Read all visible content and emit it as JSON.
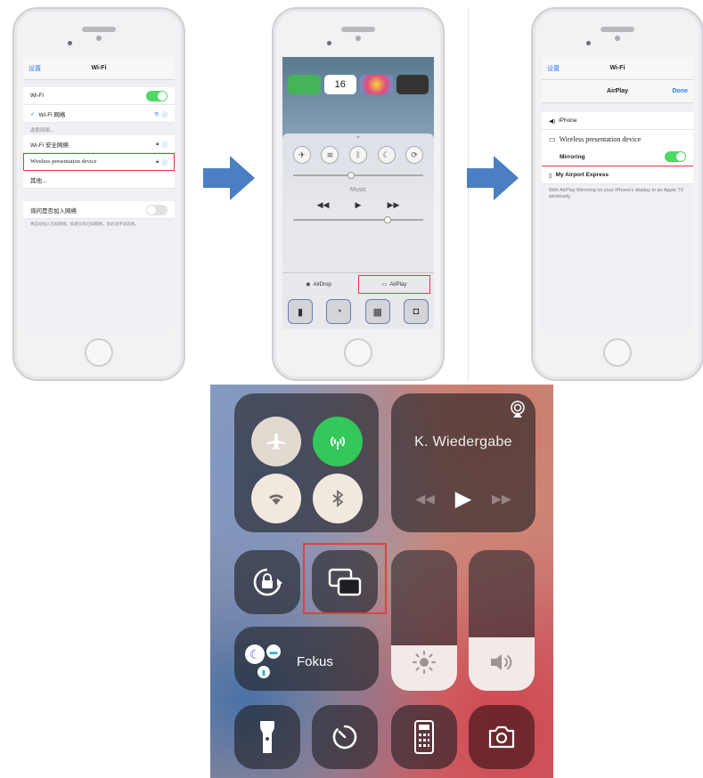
{
  "phone1": {
    "nav": {
      "back": "设置",
      "title": "Wi-Fi"
    },
    "wifi_label": "Wi-Fi",
    "connected_label": "Wi-Fi 网络",
    "section_label": "选取网络...",
    "networks": [
      "Wi-Fi 安全网络",
      "Wireless presentation device",
      "其他..."
    ],
    "ask_join_label": "询问是否加入网络",
    "ask_join_desc": "将自动加入已知网络。如果没有已知网络，您必须手动选择。"
  },
  "phone2": {
    "calendar_day": "16",
    "music_label": "Music",
    "airdrop_label": "AirDrop",
    "airplay_label": "AirPlay"
  },
  "phone3": {
    "nav": {
      "back": "设置",
      "title": "Wi-Fi"
    },
    "airplay_title": "AirPlay",
    "done_label": "Done",
    "devices": {
      "iphone": "iPhone",
      "wireless": "Wireless presentation device",
      "express": "My Airport Express"
    },
    "mirroring_label": "Mirroring",
    "footer": "With AirPlay Mirroring on your iPhone's display to an Apple TV wirelessly."
  },
  "control_center": {
    "now_playing": "K. Wiedergabe",
    "focus_label": "Fokus",
    "icons": [
      "airplane-icon",
      "cellular-icon",
      "wifi-icon",
      "bluetooth-icon",
      "rotation-lock-icon",
      "screen-mirroring-icon",
      "brightness-icon",
      "volume-icon",
      "flashlight-icon",
      "timer-icon",
      "calculator-icon",
      "camera-icon"
    ],
    "brightness_level": 0.32,
    "volume_level": 0.38
  },
  "colors": {
    "accent_blue": "#2f7cf6",
    "toggle_green": "#4cd964",
    "highlight_red": "#e2403f",
    "arrow_blue": "#4a7fc4"
  }
}
